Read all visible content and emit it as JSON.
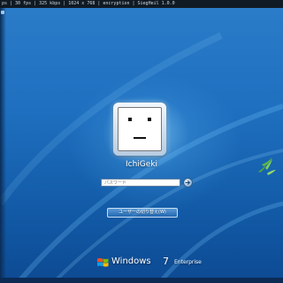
{
  "screen": {
    "overlay_text": "ps | 30 fps | 325 kbps | 1024 x 768 | encryption | SiegHeil 1.0.0",
    "accent": "#1e6fbf"
  },
  "user": {
    "name": "IchiGeki",
    "avatar": "robot-face-avatar"
  },
  "password": {
    "placeholder": "パスワード",
    "submit_icon": "arrow-right-icon"
  },
  "switch_user": {
    "label": "ユーザーの切り替え(W)"
  },
  "brand": {
    "name": "Windows",
    "version": "7",
    "edition": "Enterprise",
    "logo": "windows-flag-icon"
  }
}
